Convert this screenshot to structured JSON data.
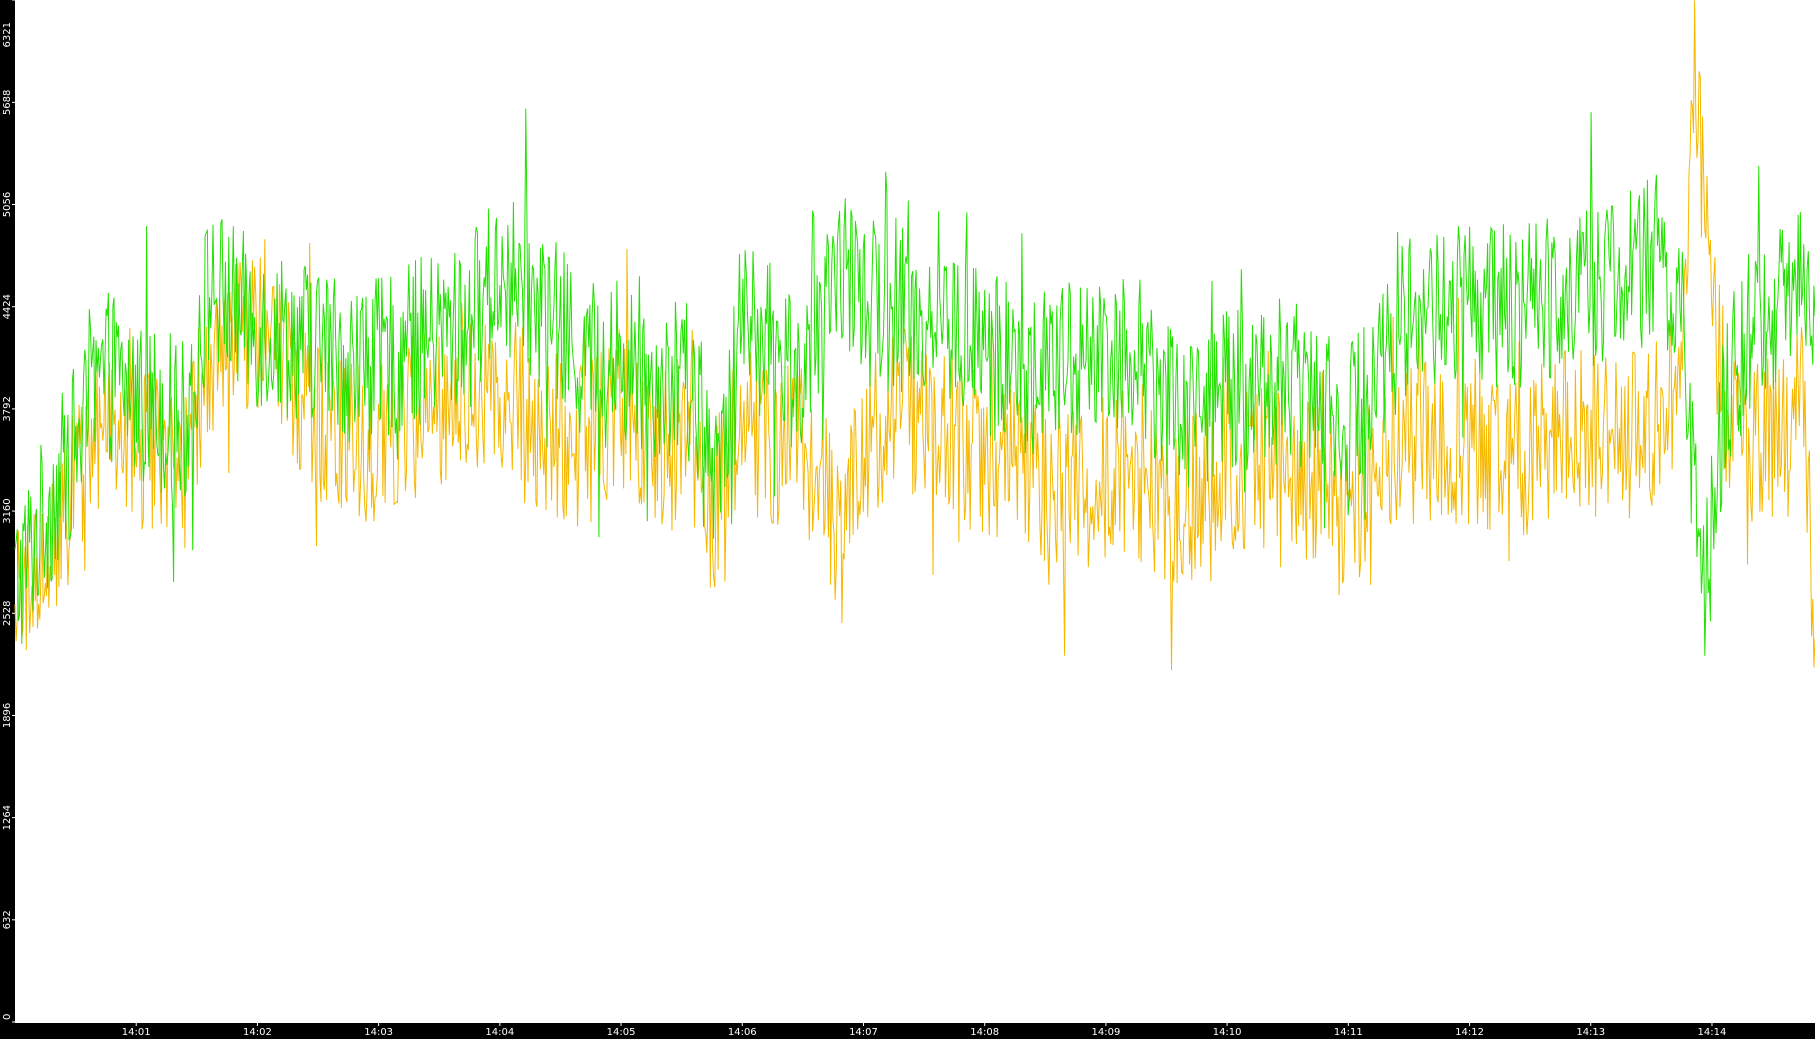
{
  "chart_data": {
    "type": "line",
    "title": "",
    "xlabel": "",
    "ylabel": "",
    "ylim": [
      0,
      6321
    ],
    "yticks": [
      0,
      632,
      1264,
      1896,
      2528,
      3160,
      3792,
      4424,
      5056,
      5688,
      6321
    ],
    "x_range_minutes": [
      0,
      14.85
    ],
    "xticks": [
      "14:01",
      "14:02",
      "14:03",
      "14:04",
      "14:05",
      "14:06",
      "14:07",
      "14:08",
      "14:09",
      "14:10",
      "14:11",
      "14:12",
      "14:13",
      "14:14"
    ],
    "grid": false,
    "legend": "none",
    "series": [
      {
        "color": "#22e000",
        "x": [
          0.0,
          0.75,
          1.4,
          1.6,
          2.0,
          2.5,
          2.9,
          3.3,
          3.7,
          4.0,
          4.3,
          4.7,
          5.0,
          5.3,
          5.6,
          5.75,
          6.0,
          6.5,
          6.65,
          6.8,
          7.0,
          7.3,
          7.6,
          8.0,
          8.4,
          8.8,
          9.2,
          9.6,
          10.0,
          10.4,
          10.8,
          11.0,
          11.2,
          11.5,
          12.0,
          12.4,
          12.8,
          13.2,
          13.5,
          13.75,
          13.85,
          13.95,
          14.1,
          14.3,
          14.6,
          14.75,
          14.85
        ],
        "values": [
          2700,
          4000,
          3700,
          4550,
          4300,
          4200,
          4050,
          4200,
          4300,
          4650,
          4450,
          4100,
          4050,
          4000,
          3900,
          3300,
          4350,
          4000,
          4150,
          4750,
          4450,
          4400,
          4350,
          4150,
          4000,
          4100,
          4200,
          3800,
          3900,
          3950,
          3950,
          3650,
          4000,
          4400,
          4450,
          4400,
          4550,
          4600,
          4700,
          4400,
          3300,
          2700,
          3800,
          4300,
          4400,
          4850,
          4250
        ]
      },
      {
        "color": "#f5b800",
        "x": [
          0.0,
          0.75,
          1.4,
          1.6,
          2.0,
          2.5,
          2.9,
          3.3,
          3.7,
          4.0,
          4.3,
          4.7,
          5.0,
          5.3,
          5.6,
          5.75,
          6.0,
          6.5,
          6.65,
          6.8,
          7.0,
          7.3,
          7.6,
          8.0,
          8.4,
          8.8,
          9.2,
          9.6,
          10.0,
          10.4,
          10.8,
          11.0,
          11.2,
          11.5,
          12.0,
          12.4,
          12.8,
          13.2,
          13.5,
          13.75,
          13.85,
          13.95,
          14.1,
          14.3,
          14.6,
          14.75,
          14.85
        ],
        "values": [
          2500,
          3700,
          3400,
          4100,
          4300,
          3650,
          3550,
          3750,
          3850,
          3950,
          3700,
          3550,
          3800,
          3500,
          3550,
          3150,
          3650,
          3550,
          3400,
          2900,
          3600,
          3800,
          3700,
          3500,
          3350,
          3300,
          3400,
          3200,
          3350,
          3450,
          3300,
          3000,
          3350,
          3600,
          3600,
          3500,
          3700,
          3600,
          3650,
          3900,
          5900,
          5000,
          3800,
          3550,
          3650,
          4100,
          2100
        ]
      }
    ]
  }
}
